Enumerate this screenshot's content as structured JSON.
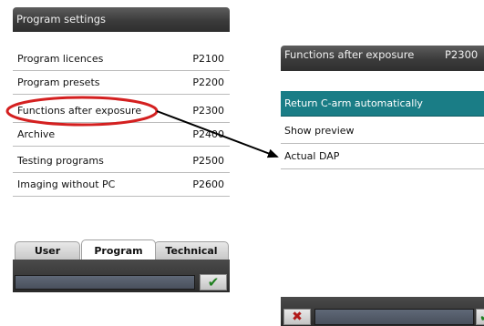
{
  "left_panel": {
    "title": "Program settings",
    "rows": [
      {
        "label": "Program licences",
        "code": "P2100"
      },
      {
        "label": "Program presets",
        "code": "P2200"
      },
      {
        "label": "Functions after exposure",
        "code": "P2300"
      },
      {
        "label": "Archive",
        "code": "P2400"
      },
      {
        "label": "Testing programs",
        "code": "P2500"
      },
      {
        "label": "Imaging without PC",
        "code": "P2600"
      }
    ],
    "tabs": {
      "user": "User",
      "program": "Program",
      "technical": "Technical",
      "active": "Program"
    },
    "ok_icon": "checkmark-icon"
  },
  "right_panel": {
    "title": "Functions after exposure",
    "title_code": "P2300",
    "rows": [
      {
        "label": "Return C-arm automatically",
        "selected": true
      },
      {
        "label": "Show preview",
        "selected": false
      },
      {
        "label": "Actual DAP",
        "selected": false
      }
    ],
    "cancel_icon": "x-icon",
    "ok_icon": "checkmark-icon"
  },
  "annotation": {
    "highlight_color": "#d42020",
    "arrow_color": "#000000"
  },
  "colors": {
    "title_bar": "#3b3b3b",
    "selected_row": "#1a7d86",
    "ok_check": "#1f7f1f",
    "cancel_x": "#b01818"
  }
}
